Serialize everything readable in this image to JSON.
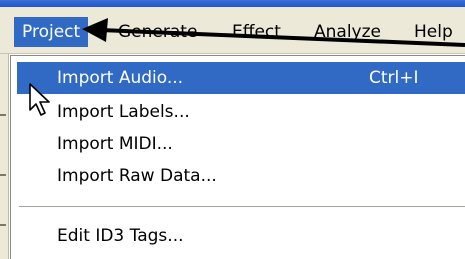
{
  "menubar": {
    "items": [
      {
        "label": "Project"
      },
      {
        "label": "Generate"
      },
      {
        "label": "Effect"
      },
      {
        "label": "Analyze"
      },
      {
        "label": "Help"
      }
    ]
  },
  "dropdown": {
    "items": [
      {
        "label": "Import Audio...",
        "shortcut": "Ctrl+I"
      },
      {
        "label": "Import Labels..."
      },
      {
        "label": "Import MIDI..."
      },
      {
        "label": "Import Raw Data..."
      },
      {
        "label": "Edit ID3 Tags..."
      }
    ]
  },
  "colors": {
    "highlight": "#316ac5",
    "menubar_bg": "#ece9d8",
    "titlebar": "#2157c9"
  },
  "icons": {
    "cursor": "arrow-cursor-icon",
    "annotation": "pointer-arrow-annotation-icon"
  }
}
